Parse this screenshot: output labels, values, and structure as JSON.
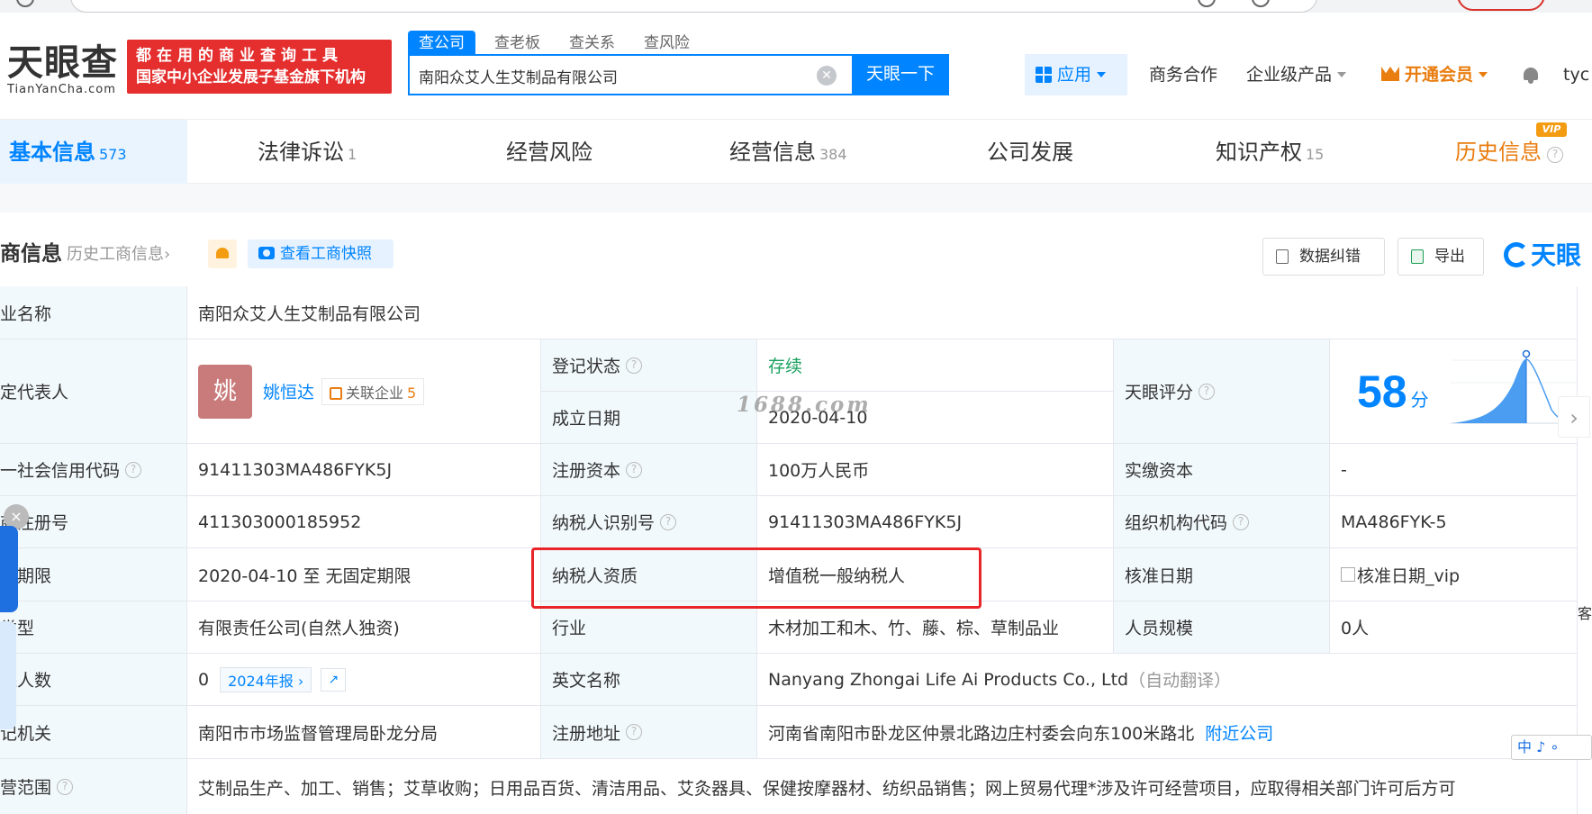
{
  "header": {
    "logo_main": "天眼查",
    "logo_sub": "TianYanCha.com",
    "promo_line1": "都在用的商业查询工具",
    "promo_line2": "国家中小企业发展子基金旗下机构",
    "search_tabs": [
      "查公司",
      "查老板",
      "查关系",
      "查风险"
    ],
    "search_value": "南阳众艾人生艾制品有限公司",
    "search_button": "天眼一下",
    "apps_label": "应用",
    "business_coop": "商务合作",
    "enterprise_products": "企业级产品",
    "vip_label": "开通会员",
    "user_name": "tyc"
  },
  "tabs": [
    {
      "label": "基本信息",
      "count": "573"
    },
    {
      "label": "法律诉讼",
      "count": "1"
    },
    {
      "label": "经营风险",
      "count": ""
    },
    {
      "label": "经营信息",
      "count": "384"
    },
    {
      "label": "公司发展",
      "count": ""
    },
    {
      "label": "知识产权",
      "count": "15"
    },
    {
      "label": "历史信息",
      "count": ""
    }
  ],
  "vip_tag": "VIP",
  "section": {
    "title": "商信息",
    "history_link": "历史工商信息",
    "history_arrow": "›",
    "snapshot_button": "查看工商快照",
    "correct_button": "数据纠错",
    "export_button": "导出",
    "brand_mark": "天眼"
  },
  "table": {
    "company_name_label": "业名称",
    "company_name": "南阳众艾人生艾制品有限公司",
    "legal_rep_label": "定代表人",
    "avatar_char": "姚",
    "legal_rep_name": "姚恒达",
    "related_label": "关联企业",
    "related_count": "5",
    "reg_status_label": "登记状态",
    "reg_status": "存续",
    "found_date_label": "成立日期",
    "found_date": "2020-04-10",
    "score_label": "天眼评分",
    "score": "58",
    "score_unit": "分",
    "credit_code_label": "一社会信用代码",
    "credit_code": "91411303MA486FYK5J",
    "reg_capital_label": "注册资本",
    "reg_capital": "100万人民币",
    "paid_capital_label": "实缴资本",
    "paid_capital": "-",
    "reg_no_label": "商注册号",
    "reg_no": "411303000185952",
    "taxpayer_id_label": "纳税人识别号",
    "taxpayer_id": "91411303MA486FYK5J",
    "org_code_label": "组织机构代码",
    "org_code": "MA486FYK-5",
    "term_label": "业期限",
    "term": "2020-04-10 至 无固定期限",
    "taxpayer_qual_label": "纳税人资质",
    "taxpayer_qual": "增值税一般纳税人",
    "approval_date_label": "核准日期",
    "approval_date": "核准日期_vip",
    "type_label": "类型",
    "type": "有限责任公司(自然人独资)",
    "industry_label": "行业",
    "industry": "木材加工和木、竹、藤、棕、草制品业",
    "staff_size_label": "人员规模",
    "staff_size": "0人",
    "insured_label": "保人数",
    "insured": "0",
    "report_badge": "2024年报",
    "english_name_label": "英文名称",
    "english_name": "Nanyang Zhongai Life Ai Products Co., Ltd",
    "auto_translate": "（自动翻译）",
    "authority_label": "记机关",
    "authority": "南阳市市场监督管理局卧龙分局",
    "address_label": "注册地址",
    "address": "河南省南阳市卧龙区仲景北路边庄村委会向东100米路北",
    "nearby_link": "附近公司",
    "scope_label": "营范围",
    "scope": "艾制品生产、加工、销售；艾草收购；日用品百货、清洁用品、艾灸器具、保健按摩器材、纺织品销售；网上贸易代理*涉及许可经营项目，应取得相关部门许可后方可"
  },
  "watermark": "1688.com",
  "ime_bar": "中 ♪ ∘",
  "side_char": "客",
  "colors": {
    "brand_blue": "#0084ff",
    "highlight_red": "#e8262a",
    "status_green": "#1aa15f",
    "vip_orange": "#e97d10",
    "promo_red": "#e52e2e"
  }
}
